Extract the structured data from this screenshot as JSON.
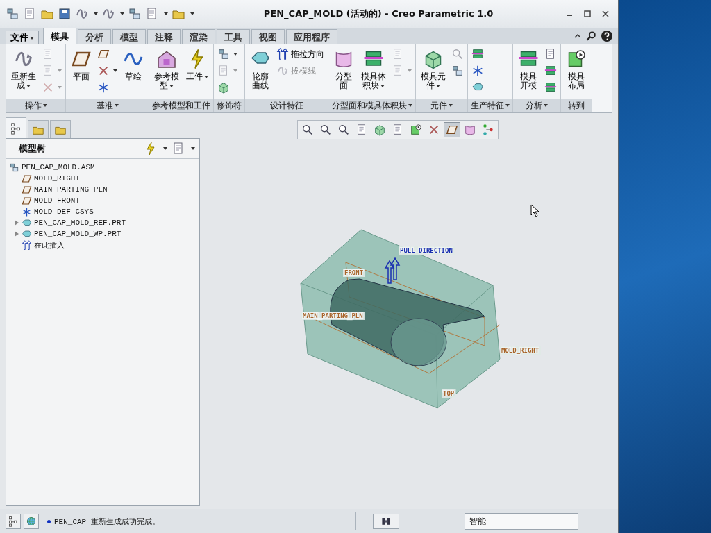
{
  "window": {
    "title": "PEN_CAP_MOLD (活动的) - Creo Parametric 1.0"
  },
  "file_menu": {
    "label": "文件"
  },
  "tabs": [
    {
      "label": "模具",
      "selected": true
    },
    {
      "label": "分析",
      "selected": false
    },
    {
      "label": "模型",
      "selected": false
    },
    {
      "label": "注释",
      "selected": false
    },
    {
      "label": "渲染",
      "selected": false
    },
    {
      "label": "工具",
      "selected": false
    },
    {
      "label": "视图",
      "selected": false
    },
    {
      "label": "应用程序",
      "selected": false
    }
  ],
  "ribbon": [
    {
      "label": "操作",
      "dropdown": true,
      "items": [
        {
          "kind": "large",
          "lines": [
            "重新生",
            "成"
          ],
          "dropdown": true,
          "disabled": false
        },
        {
          "kind": "icon",
          "dropdown": false,
          "disabled": true
        },
        {
          "kind": "icon",
          "dropdown": true,
          "disabled": true
        },
        {
          "kind": "icon",
          "dropdown": true,
          "disabled": true
        }
      ]
    },
    {
      "label": "基准",
      "dropdown": true,
      "items": [
        {
          "kind": "large",
          "lines": [
            "平面"
          ],
          "dropdown": false,
          "disabled": false
        },
        {
          "kind": "icon",
          "dropdown": false,
          "disabled": false
        },
        {
          "kind": "icon",
          "dropdown": true,
          "disabled": false
        },
        {
          "kind": "icon",
          "dropdown": false,
          "disabled": false
        },
        {
          "kind": "large",
          "lines": [
            "草绘"
          ],
          "dropdown": false,
          "disabled": false
        }
      ]
    },
    {
      "label": "参考模型和工件",
      "dropdown": false,
      "items": [
        {
          "kind": "large",
          "lines": [
            "参考模",
            "型"
          ],
          "dropdown": true,
          "disabled": false
        },
        {
          "kind": "large",
          "lines": [
            "工件"
          ],
          "dropdown": true,
          "disabled": false
        }
      ]
    },
    {
      "label": "修饰符",
      "dropdown": false,
      "items": [
        {
          "kind": "icon",
          "dropdown": true,
          "disabled": false
        },
        {
          "kind": "icon",
          "dropdown": true,
          "disabled": true
        },
        {
          "kind": "icon",
          "dropdown": false,
          "disabled": false
        }
      ]
    },
    {
      "label": "设计特征",
      "dropdown": false,
      "items": [
        {
          "kind": "large",
          "lines": [
            "轮廓",
            "曲线"
          ],
          "dropdown": false,
          "disabled": false
        },
        {
          "kind": "small",
          "lines": [
            "拖拉方向"
          ],
          "dropdown": false,
          "disabled": false
        },
        {
          "kind": "small",
          "lines": [
            "拔模线"
          ],
          "dropdown": false,
          "disabled": true
        }
      ]
    },
    {
      "label": "分型面和模具体积块",
      "dropdown": true,
      "items": [
        {
          "kind": "large",
          "lines": [
            "分型",
            "面"
          ],
          "dropdown": false,
          "disabled": false
        },
        {
          "kind": "large",
          "lines": [
            "模具体",
            "积块"
          ],
          "dropdown": true,
          "disabled": false
        },
        {
          "kind": "icon",
          "dropdown": false,
          "disabled": true
        },
        {
          "kind": "icon",
          "dropdown": true,
          "disabled": true
        }
      ]
    },
    {
      "label": "元件",
      "dropdown": true,
      "items": [
        {
          "kind": "large",
          "lines": [
            "模具元",
            "件"
          ],
          "dropdown": true,
          "disabled": false
        },
        {
          "kind": "icon",
          "dropdown": false,
          "disabled": true
        },
        {
          "kind": "icon",
          "dropdown": false,
          "disabled": false
        }
      ]
    },
    {
      "label": "生产特征",
      "dropdown": true,
      "items": [
        {
          "kind": "icon",
          "dropdown": false,
          "disabled": false
        },
        {
          "kind": "icon",
          "dropdown": false,
          "disabled": false
        },
        {
          "kind": "icon",
          "dropdown": false,
          "disabled": false
        }
      ]
    },
    {
      "label": "分析",
      "dropdown": true,
      "items": [
        {
          "kind": "large",
          "lines": [
            "模具",
            "开模"
          ],
          "dropdown": false,
          "disabled": false
        },
        {
          "kind": "icon",
          "dropdown": false,
          "disabled": false
        },
        {
          "kind": "icon",
          "dropdown": false,
          "disabled": false
        },
        {
          "kind": "icon",
          "dropdown": false,
          "disabled": false
        }
      ]
    },
    {
      "label": "转到",
      "dropdown": false,
      "items": [
        {
          "kind": "large",
          "lines": [
            "模具",
            "布局"
          ],
          "dropdown": false,
          "disabled": false
        }
      ]
    }
  ],
  "panel_tabs": [
    {
      "selected": true
    },
    {
      "selected": false
    },
    {
      "selected": false
    }
  ],
  "model_tree": {
    "title": "模型树",
    "items": [
      {
        "label": "PEN_CAP_MOLD.ASM",
        "kind": "assembly",
        "children": [
          {
            "label": "MOLD_RIGHT",
            "kind": "plane"
          },
          {
            "label": "MAIN_PARTING_PLN",
            "kind": "plane"
          },
          {
            "label": "MOLD_FRONT",
            "kind": "plane"
          },
          {
            "label": "MOLD_DEF_CSYS",
            "kind": "csys"
          },
          {
            "label": "PEN_CAP_MOLD_REF.PRT",
            "kind": "part",
            "expanded": false
          },
          {
            "label": "PEN_CAP_MOLD_WP.PRT",
            "kind": "workpiece",
            "expanded": false
          },
          {
            "label": "在此插入",
            "kind": "insert"
          }
        ]
      }
    ]
  },
  "graphics_toolbar": [
    {
      "selected": false
    },
    {
      "selected": false
    },
    {
      "selected": false
    },
    {
      "selected": false
    },
    {
      "selected": false
    },
    {
      "selected": false
    },
    {
      "selected": false
    },
    {
      "selected": false
    },
    {
      "selected": true
    },
    {
      "selected": false
    },
    {
      "selected": false
    }
  ],
  "model_labels": [
    {
      "label": "PULL DIRECTION",
      "kind": "direction"
    },
    {
      "label": "FRONT",
      "kind": "datum"
    },
    {
      "label": "MAIN_PARTING_PLN",
      "kind": "datum"
    },
    {
      "label": "MOLD_RIGHT",
      "kind": "datum"
    },
    {
      "label": "TOP",
      "kind": "datum"
    }
  ],
  "status_bar": {
    "message": "PEN_CAP 重新生成成功完成。",
    "filter": "智能"
  }
}
